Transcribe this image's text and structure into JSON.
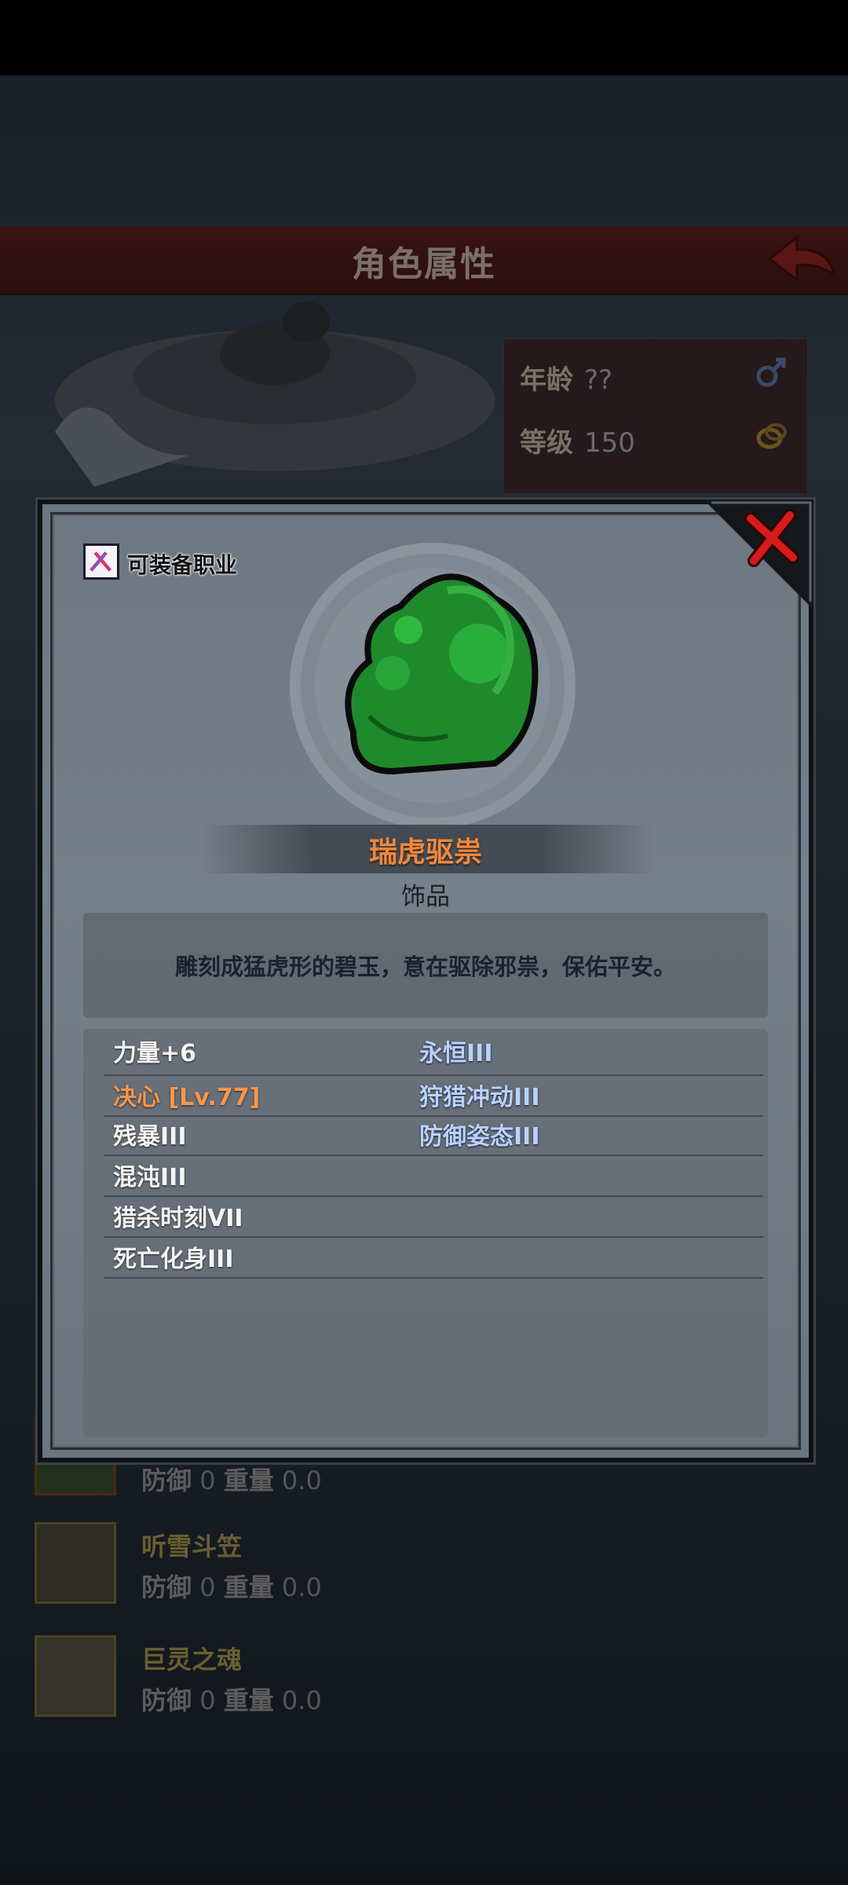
{
  "background": {
    "header_title": "角色属性",
    "info": {
      "age_label": "年龄",
      "age_value": "??",
      "level_label": "等级",
      "level_value": "150"
    },
    "list": [
      {
        "name": "",
        "defense_label": "防御",
        "defense_value": "0",
        "weight_label": "重量",
        "weight_value": "0.0"
      },
      {
        "name": "听雪斗笠",
        "defense_label": "防御",
        "defense_value": "0",
        "weight_label": "重量",
        "weight_value": "0.0"
      },
      {
        "name": "巨灵之魂",
        "defense_label": "防御",
        "defense_value": "0",
        "weight_label": "重量",
        "weight_value": "0.0"
      }
    ]
  },
  "modal": {
    "job_label": "可装备职业",
    "item_name": "瑞虎驱祟",
    "item_type": "饰品",
    "description": "雕刻成猛虎形的碧玉，意在驱除邪祟，保佑平安。",
    "attributes_left": [
      "力量+6",
      "决心 [Lv.77]",
      "残暴III",
      "混沌III",
      "猎杀时刻VII",
      "死亡化身III"
    ],
    "attributes_right": [
      "永恒III",
      "狩猎冲动III",
      "防御姿态III"
    ]
  },
  "colors": {
    "item_name": "#f0883c",
    "attr_highlight": "#f6964c",
    "attr_blue": "#b9d2ff",
    "close_red": "#d81a1a"
  },
  "icons": [
    "back-arrow-icon",
    "male-icon",
    "ring-icon",
    "job-icon",
    "close-icon",
    "jade-tiger-icon"
  ]
}
